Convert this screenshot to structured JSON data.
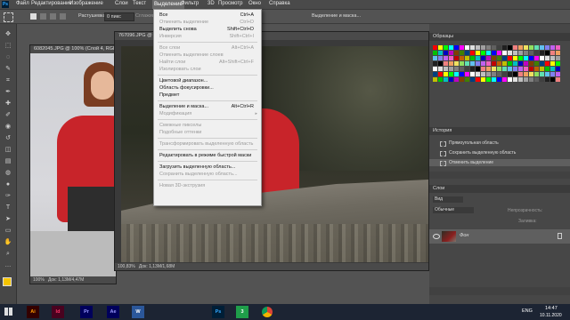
{
  "menubar": {
    "items": [
      "Файл",
      "Редактирование",
      "Изображение",
      "Слои",
      "Текст",
      "Выделение",
      "Фильтр",
      "3D",
      "Просмотр",
      "Окно",
      "Справка"
    ],
    "active_index": 5
  },
  "optbar": {
    "feather_label": "Растушевка:",
    "feather_value": "0 пикс",
    "antialias_label": "Сглаживание",
    "select_mask_label": "Выделение и маска..."
  },
  "docs": {
    "back_tab": "6082045.JPG @ 100% (Слой 4, RGB/8)",
    "back_zoom": "100%",
    "back_status": "Док: 1,13M/4,47M",
    "front_tab": "767096.JPG @",
    "front_zoom": "100,83%",
    "front_status": "Док: 1,13M/1,68M"
  },
  "select_menu": {
    "items": [
      {
        "label": "Все",
        "shortcut": "Ctrl+A",
        "disabled": false
      },
      {
        "label": "Отменить выделение",
        "shortcut": "Ctrl+D",
        "disabled": true
      },
      {
        "label": "Выделить снова",
        "shortcut": "Shift+Ctrl+D",
        "disabled": false
      },
      {
        "label": "Инверсия",
        "shortcut": "Shift+Ctrl+I",
        "disabled": true
      },
      {
        "sep": true
      },
      {
        "label": "Все слои",
        "shortcut": "Alt+Ctrl+A",
        "disabled": true
      },
      {
        "label": "Отменить выделение слоев",
        "shortcut": "",
        "disabled": true
      },
      {
        "label": "Найти слои",
        "shortcut": "Alt+Shift+Ctrl+F",
        "disabled": true
      },
      {
        "label": "Изолировать слои",
        "shortcut": "",
        "disabled": true
      },
      {
        "sep": true
      },
      {
        "label": "Цветовой диапазон...",
        "shortcut": "",
        "disabled": false
      },
      {
        "label": "Область фокусировки...",
        "shortcut": "",
        "disabled": false
      },
      {
        "label": "Предмет",
        "shortcut": "",
        "disabled": false
      },
      {
        "sep": true
      },
      {
        "label": "Выделение и маска...",
        "shortcut": "Alt+Ctrl+R",
        "disabled": false
      },
      {
        "label": "Модификация",
        "shortcut": "",
        "disabled": true,
        "submenu": true
      },
      {
        "sep": true
      },
      {
        "label": "Смежные пикселы",
        "shortcut": "",
        "disabled": true
      },
      {
        "label": "Подобные оттенки",
        "shortcut": "",
        "disabled": true
      },
      {
        "sep": true
      },
      {
        "label": "Трансформировать выделенную область",
        "shortcut": "",
        "disabled": true
      },
      {
        "sep": true
      },
      {
        "label": "Редактировать в режиме быстрой маски",
        "shortcut": "",
        "disabled": false
      },
      {
        "sep": true
      },
      {
        "label": "Загрузить выделенную область...",
        "shortcut": "",
        "disabled": false
      },
      {
        "label": "Сохранить выделенную область...",
        "shortcut": "",
        "disabled": true
      },
      {
        "sep": true
      },
      {
        "label": "Новая 3D-экструзия",
        "shortcut": "",
        "disabled": true
      }
    ]
  },
  "panels": {
    "swatches_title": "Образцы",
    "history_title": "История",
    "history_items": [
      "Прямоугольная область",
      "Сохранить выделенную область",
      "Отменить выделение"
    ],
    "layers_title": "Слои",
    "layers_kind": "Вид",
    "layers_blend": "Обычные",
    "layers_opacity_label": "Непрозрачность:",
    "layers_fill_label": "Заливка:",
    "layer_name": "Фон"
  },
  "swatch_colors": [
    "#ff0000",
    "#ffff00",
    "#00ff00",
    "#00ffff",
    "#0000ff",
    "#ff00ff",
    "#ffffff",
    "#e0e0e0",
    "#c0c0c0",
    "#a0a0a0",
    "#808080",
    "#606060",
    "#404040",
    "#202020",
    "#000000",
    "#f08080",
    "#f0a060",
    "#f0e060",
    "#90e060",
    "#60e0b0",
    "#60c0f0",
    "#8080f0",
    "#c060f0",
    "#f060c0",
    "#c00000",
    "#c06000",
    "#c0c000",
    "#00c000",
    "#00c0c0",
    "#0000c0",
    "#c000c0",
    "#804000",
    "#408000",
    "#004080"
  ],
  "taskbar": {
    "apps": [
      {
        "label": "Ai",
        "color": "#ff9a00",
        "bg": "#330000"
      },
      {
        "label": "Id",
        "color": "#ff3366",
        "bg": "#49021f"
      },
      {
        "label": "Pr",
        "color": "#9999ff",
        "bg": "#00005b"
      },
      {
        "label": "Ae",
        "color": "#9999ff",
        "bg": "#00005b"
      },
      {
        "label": "W",
        "color": "#ffffff",
        "bg": "#2b579a"
      },
      {
        "label": "Ps",
        "color": "#31a8ff",
        "bg": "#001e36"
      },
      {
        "label": "3",
        "color": "#ffffff",
        "bg": "#1f9e4a"
      }
    ],
    "lang": "ENG",
    "time": "14:47",
    "date": "10.11.2020"
  }
}
